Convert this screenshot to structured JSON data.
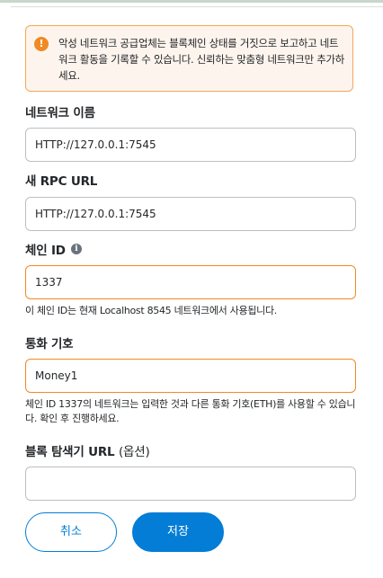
{
  "warning": {
    "icon": "exclamation-icon",
    "text": "악성 네트워크 공급업체는 블록체인 상태를 거짓으로 보고하고 네트워크 활동을 기록할 수 있습니다. 신뢰하는 맞춤형 네트워크만 추가하세요.",
    "color": "#f08a24"
  },
  "form": {
    "network_name": {
      "label": "네트워크 이름",
      "value": "HTTP://127.0.0.1:7545"
    },
    "rpc_url": {
      "label": "새 RPC URL",
      "value": "HTTP://127.0.0.1:7545"
    },
    "chain_id": {
      "label": "체인 ID",
      "info_icon": "info-icon",
      "value": "1337",
      "help": "이 체인 ID는 현재 Localhost 8545 네트워크에서 사용됩니다."
    },
    "currency_symbol": {
      "label": "통화 기호",
      "value": "Money1",
      "help": "체인 ID 1337의 네트워크는 입력한 것과 다른 통화 기호(ETH)를 사용할 수 있습니다. 확인 후 진행하세요."
    },
    "block_explorer": {
      "label": "블록 탐색기 URL",
      "label_optional": "(옵션)",
      "value": ""
    }
  },
  "buttons": {
    "cancel": "취소",
    "save": "저장"
  },
  "colors": {
    "primary": "#037dd6",
    "warning_border": "#f08a24",
    "warning_bg": "#fdf4ed"
  }
}
